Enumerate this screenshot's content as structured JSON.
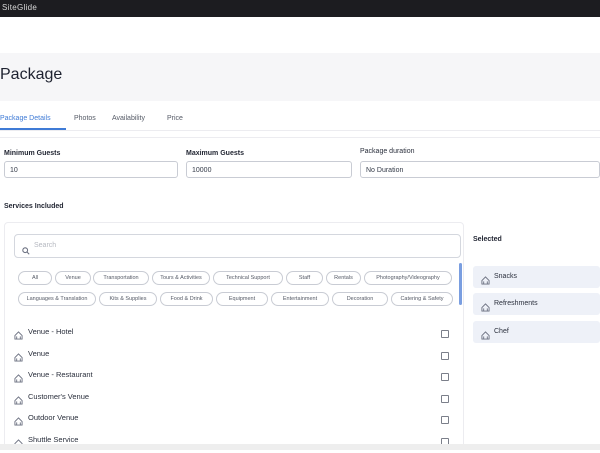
{
  "window": {
    "title": "SiteGlide"
  },
  "page": {
    "title": "Package"
  },
  "tabs": [
    {
      "label": "Package Details",
      "active": true
    },
    {
      "label": "Photos",
      "active": false
    },
    {
      "label": "Availability",
      "active": false
    },
    {
      "label": "Price",
      "active": false
    }
  ],
  "fields": {
    "min_guests": {
      "label": "Minimum Guests",
      "value": "10"
    },
    "max_guests": {
      "label": "Maximum Guests",
      "value": "10000"
    },
    "duration": {
      "label": "Package duration",
      "value": "No Duration"
    }
  },
  "services": {
    "label": "Services Included",
    "search_placeholder": "Search",
    "categories_row1": [
      "All",
      "Venue",
      "Transportation",
      "Tours & Activities",
      "Technical Support",
      "Staff",
      "Rentals",
      "Photography/Videography"
    ],
    "categories_row2": [
      "Languages & Translation",
      "Kits & Supplies",
      "Food & Drink",
      "Equipment",
      "Entertainment",
      "Decoration",
      "Catering & Safety"
    ],
    "items": [
      {
        "label": "Venue - Hotel",
        "checked": false
      },
      {
        "label": "Venue",
        "checked": false
      },
      {
        "label": "Venue - Restaurant",
        "checked": false
      },
      {
        "label": "Customer's Venue",
        "checked": false
      },
      {
        "label": "Outdoor Venue",
        "checked": false
      },
      {
        "label": "Shuttle Service",
        "checked": false
      }
    ]
  },
  "selected": {
    "label": "Selected",
    "items": [
      "Snacks",
      "Refreshments",
      "Chef"
    ]
  },
  "colors": {
    "accent": "#3f7bd6",
    "chip_border": "#c9ccd4",
    "selected_bg": "#eef1f8"
  },
  "icons": {
    "search": "search-icon",
    "service": "service-icon"
  }
}
